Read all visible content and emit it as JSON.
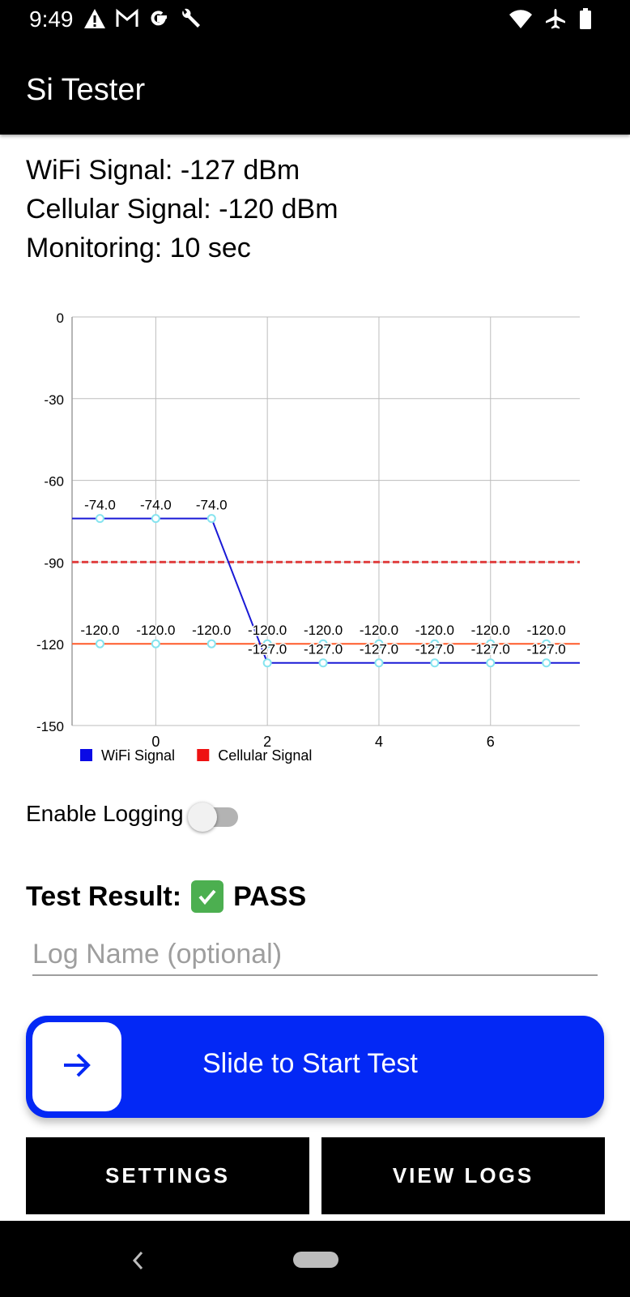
{
  "status_bar": {
    "time": "9:49",
    "left_icons": [
      "warning-icon",
      "gmail-icon",
      "google-icon",
      "wrench-icon"
    ],
    "right_icons": [
      "wifi-icon",
      "airplane-icon",
      "battery-icon"
    ]
  },
  "app_bar": {
    "title": "Si Tester"
  },
  "info": {
    "wifi": "WiFi Signal: -127 dBm",
    "cellular": "Cellular Signal: -120 dBm",
    "monitoring": "Monitoring: 10 sec"
  },
  "chart_data": {
    "type": "line",
    "x": [
      -1,
      0,
      1,
      2,
      3,
      4,
      5,
      6,
      7
    ],
    "xlim": [
      -1.5,
      7.6
    ],
    "ylim": [
      -150,
      0
    ],
    "x_ticks": [
      0,
      2,
      4,
      6
    ],
    "y_ticks": [
      0,
      -30,
      -60,
      -90,
      -120,
      -150
    ],
    "grid": true,
    "legend_position": "bottom-left",
    "series": [
      {
        "name": "WiFi Signal",
        "color": "#1a1ad6",
        "values": [
          -74,
          -74,
          -74,
          -127,
          -127,
          -127,
          -127,
          -127,
          -127
        ],
        "labels": [
          "-74.0",
          "-74.0",
          "-74.0",
          "-127.0",
          "-127.0",
          "-127.0",
          "-127.0",
          "-127.0",
          "-127.0"
        ]
      },
      {
        "name": "Cellular Signal",
        "color": "#ff5a28",
        "values": [
          -120,
          -120,
          -120,
          -120,
          -120,
          -120,
          -120,
          -120,
          -120
        ],
        "labels": [
          "-120.0",
          "-120.0",
          "-120.0",
          "-120.0",
          "-120.0",
          "-120.0",
          "-120.0",
          "-120.0",
          "-120.0"
        ]
      }
    ],
    "legend_colors": {
      "WiFi Signal": "#0a0ae6",
      "Cellular Signal": "#ee1111"
    },
    "threshold": {
      "value": -90,
      "style": "dashed",
      "color": "#e04040"
    },
    "marker_color": "#86e4ef"
  },
  "logging": {
    "label": "Enable Logging",
    "enabled": false
  },
  "result": {
    "label": "Test Result:",
    "value": "PASS"
  },
  "log_name": {
    "placeholder": "Log Name (optional)",
    "value": ""
  },
  "slider": {
    "label": "Slide to Start Test",
    "icon": "arrow-right-icon"
  },
  "buttons": {
    "settings": "SETTINGS",
    "view_logs": "VIEW LOGS"
  },
  "nav": {
    "back_icon": "back-icon",
    "home_icon": "home-pill-icon"
  },
  "colors": {
    "accent_blue": "#0328f5",
    "bar_black": "#000000",
    "pass_green": "#4caf50"
  }
}
